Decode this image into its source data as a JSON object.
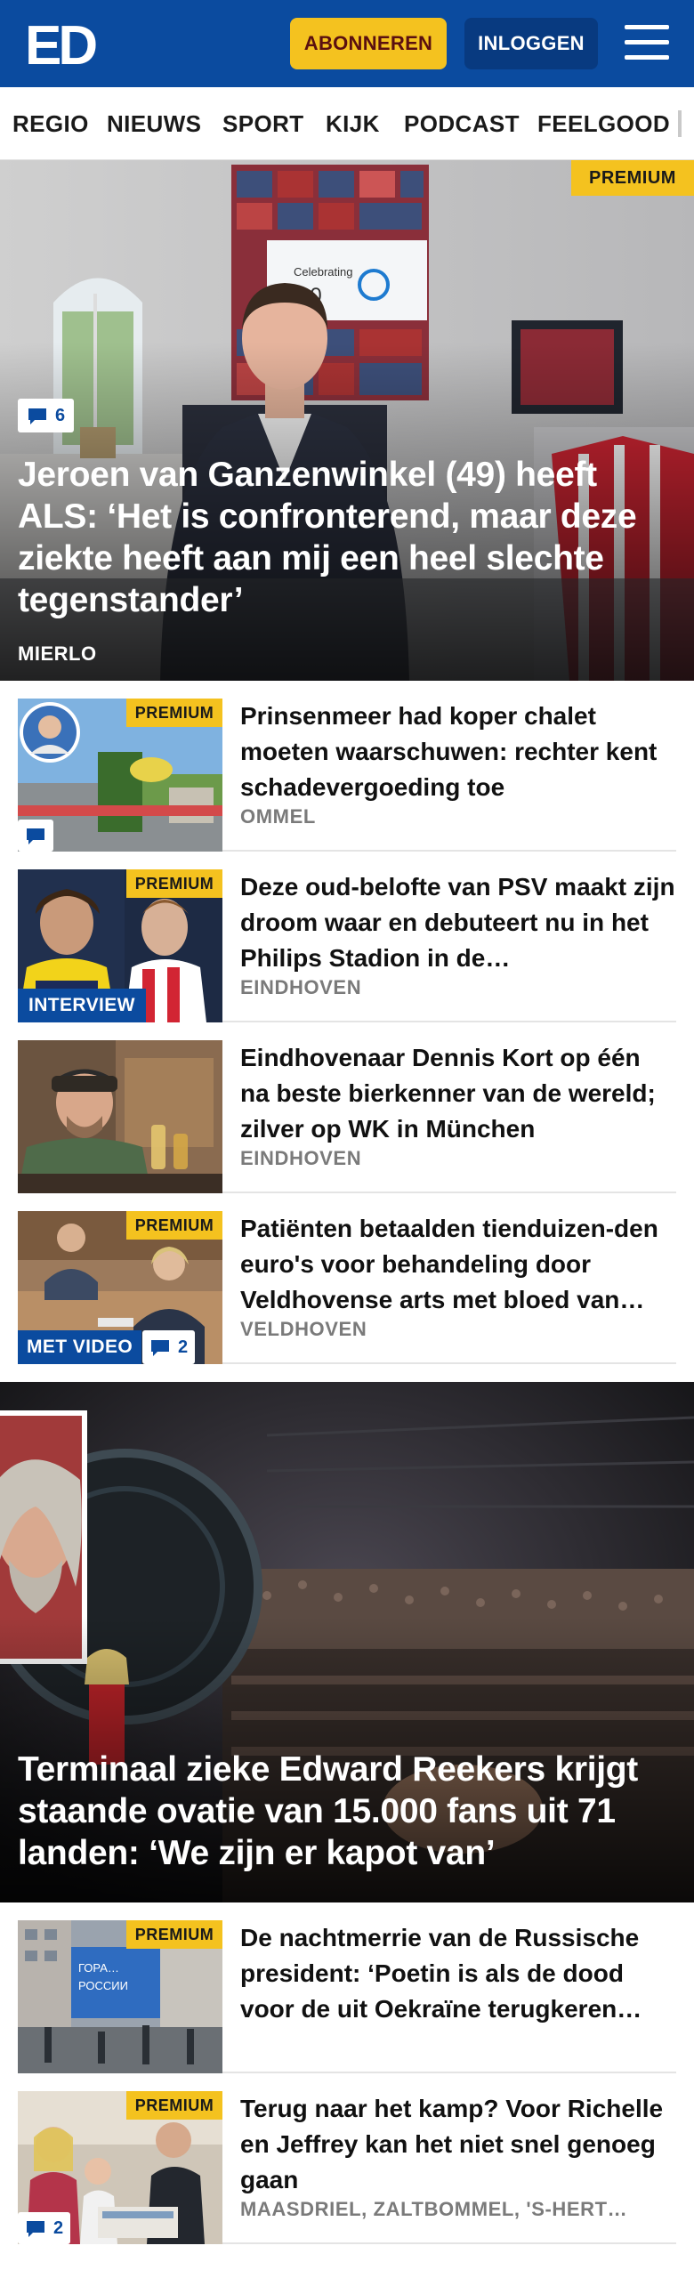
{
  "header": {
    "logo_text": "ED",
    "subscribe_label": "ABONNEREN",
    "login_label": "INLOGGEN"
  },
  "nav": {
    "items": [
      "REGIO",
      "NIEUWS",
      "SPORT",
      "KIJK",
      "PODCAST",
      "FEELGOOD"
    ]
  },
  "hero": {
    "premium": "PREMIUM",
    "comments": "6",
    "title": "Jeroen van Ganzenwinkel (49) heeft ALS: ‘Het is confronterend, maar deze ziekte heeft aan mij een heel slechte tegenstander’",
    "location": "MIERLO",
    "poster_text": "Celebrating 10"
  },
  "articles": [
    {
      "premium": "PREMIUM",
      "title": "Prinsenmeer had koper chalet moeten waarschuwen: rechter kent schadevergoeding toe",
      "location": "OMMEL",
      "comments": ""
    },
    {
      "premium": "PREMIUM",
      "tag": "INTERVIEW",
      "title": "Deze oud-belofte van PSV maakt zijn droom waar en debuteert nu in het Philips Stadion in de…",
      "location": "EINDHOVEN"
    },
    {
      "title": "Eindhovenaar Dennis Kort op één na beste bierkenner van de wereld; zilver op WK in München",
      "location": "EINDHOVEN"
    },
    {
      "premium": "PREMIUM",
      "tag": "MET VIDEO",
      "comments": "2",
      "title": "Patiënten betaalden tienduizen-den euro's voor behandeling door Veldhovense arts met bloed van…",
      "location": "VELDHOVEN"
    }
  ],
  "video_hero": {
    "title": "Terminaal zieke Edward Reekers krijgt staande ovatie van 15.000 fans uit 71 landen: ‘We zijn er kapot van’"
  },
  "articles2": [
    {
      "premium": "PREMIUM",
      "title": "De nachtmerrie van de Russische president: ‘Poetin is als de dood voor de uit Oekraïne terugkeren…",
      "location": ""
    },
    {
      "premium": "PREMIUM",
      "comments": "2",
      "title": "Terug naar het kamp? Voor Richelle en Jeffrey kan het niet snel genoeg gaan",
      "location": "MAASDRIEL, ZALTBOMMEL, 'S-HERT…"
    }
  ],
  "colors": {
    "brand_blue": "#0b4b9f",
    "premium_yellow": "#f4c21f"
  }
}
